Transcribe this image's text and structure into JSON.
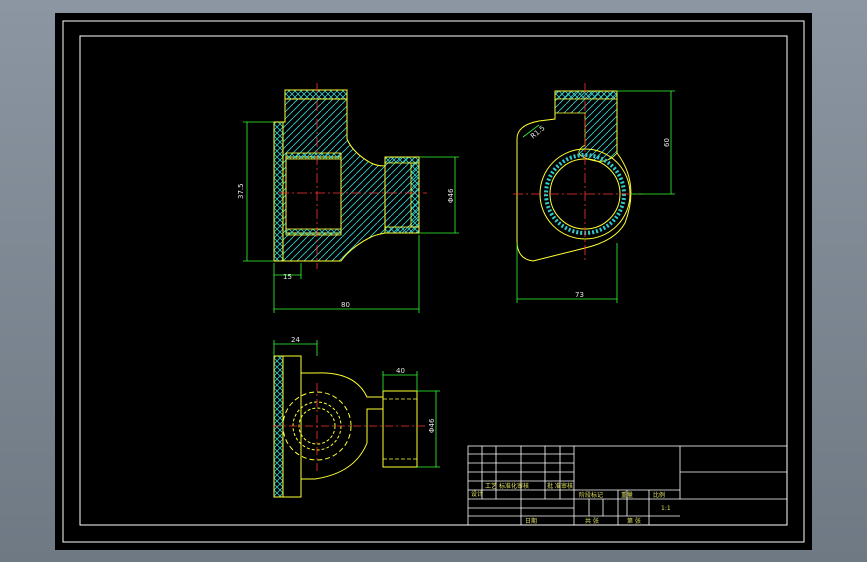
{
  "drawing": {
    "colors": {
      "background": "#000000",
      "frame": "#ffffff",
      "outline": "#ffff33",
      "hatch": "#33cccc",
      "dimension": "#33ff33",
      "centerline": "#ff3333"
    },
    "dimensions": {
      "front_height": "37.5",
      "front_diameter": "Φ46",
      "front_wall": "15",
      "front_length": "80",
      "side_chamfer": "R1.5",
      "side_height": "60",
      "side_width": "73",
      "top_flange": "24",
      "top_width": "40",
      "top_diameter": "Φ46"
    },
    "title_block": {
      "designer": "设计",
      "process": "工艺",
      "standard": "标准化审核",
      "approve": "批 准",
      "date": "日期",
      "stage_mark": "阶段标记",
      "weight": "重量",
      "scale_label": "比例",
      "scale": "1:1",
      "sheet": "共 张",
      "sheet_no": "第 张",
      "check": "审核"
    }
  }
}
